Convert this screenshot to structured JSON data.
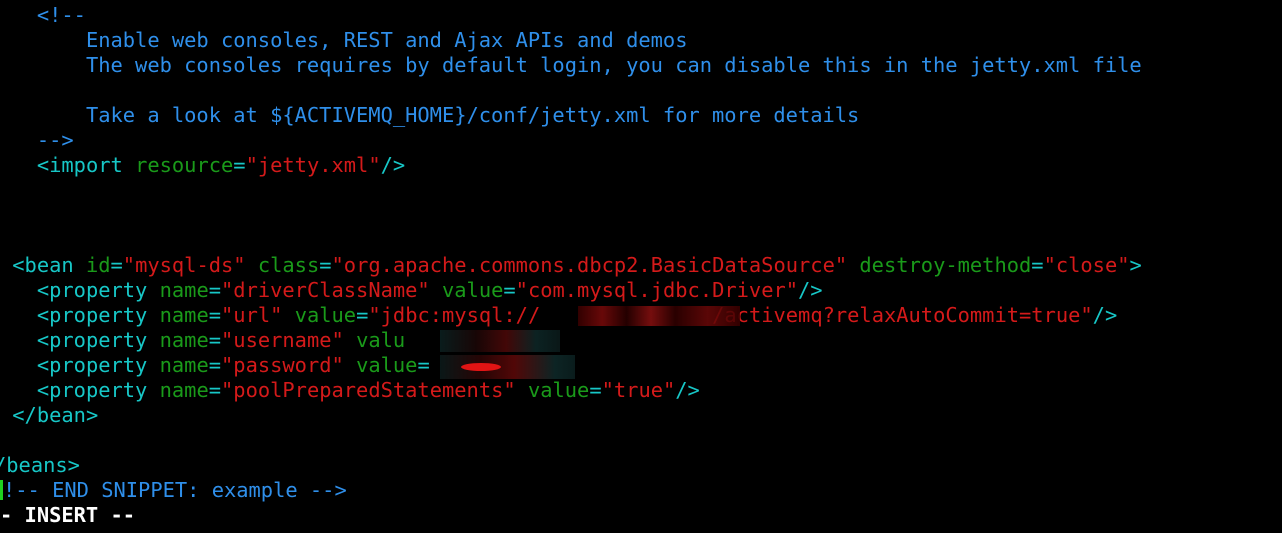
{
  "editor": {
    "mode_label": "- INSERT --"
  },
  "comment_block": {
    "open": "<!--",
    "line1": "Enable web consoles, REST and Ajax APIs and demos",
    "line2": "The web consoles requires by default login, you can disable this in the jetty.xml file",
    "line3": "Take a look at ${ACTIVEMQ_HOME}/conf/jetty.xml for more details",
    "close": "-->"
  },
  "import_line": {
    "open": "<import",
    "attr": "resource",
    "eq": "=",
    "value": "\"jetty.xml\"",
    "close": "/>"
  },
  "bean": {
    "open": "<bean",
    "id_attr": "id",
    "id_value": "\"mysql-ds\"",
    "class_attr": "class",
    "class_value": "\"org.apache.commons.dbcp2.BasicDataSource\"",
    "destroy_attr": "destroy-method",
    "destroy_value": "\"close\"",
    "open_end": ">",
    "close": "</bean>"
  },
  "properties": [
    {
      "tag": "<property",
      "name_attr": "name",
      "name_value": "\"driverClassName\"",
      "value_attr": "value",
      "value": "\"com.mysql.jdbc.Driver\"",
      "end": "/>"
    },
    {
      "tag": "<property",
      "name_attr": "name",
      "name_value": "\"url\"",
      "value_attr": "value",
      "value_prefix": "\"jdbc:mysql://",
      "value_suffix": "/activemq?relaxAutoCommit=true\"",
      "end": "/>"
    },
    {
      "tag": "<property",
      "name_attr": "name",
      "name_value": "\"username\"",
      "value_attr": "valu"
    },
    {
      "tag": "<property",
      "name_attr": "name",
      "name_value": "\"password\"",
      "value_attr": "value"
    },
    {
      "tag": "<property",
      "name_attr": "name",
      "name_value": "\"poolPreparedStatements\"",
      "value_attr": "value",
      "value": "\"true\"",
      "end": "/>"
    }
  ],
  "beans_close": "/beans>",
  "end_snippet": "!-- END SNIPPET: example -->",
  "eq": "=",
  "colors": {
    "background": "#000000",
    "comment": "#2f8fea",
    "tag": "#17c7c7",
    "attribute": "#1a9a1a",
    "string": "#d41a1a",
    "cursor": "#1fd11f"
  }
}
